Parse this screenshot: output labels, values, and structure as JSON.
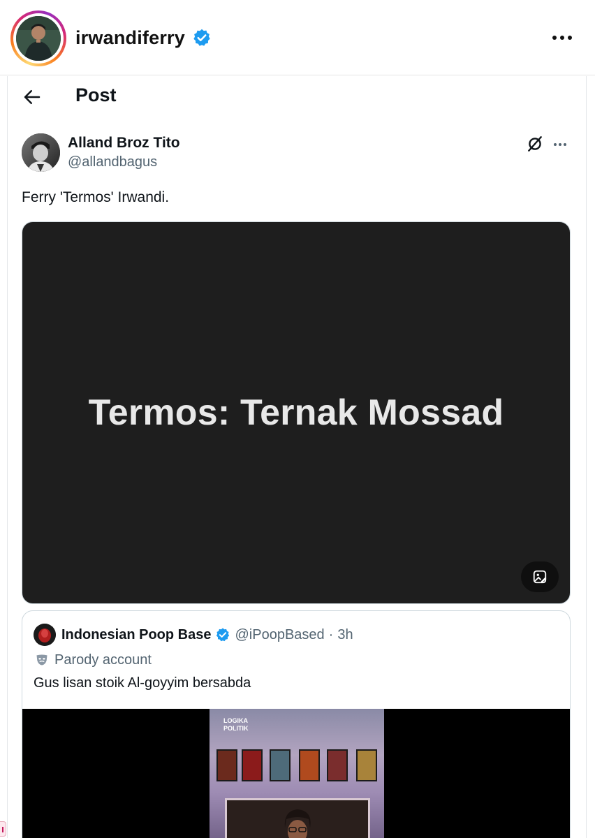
{
  "instagram_header": {
    "username": "irwandiferry",
    "verified_icon": "verified-badge-icon",
    "more_icon": "more-horizontal-icon"
  },
  "post_screen": {
    "title": "Post",
    "back_icon": "arrow-left-icon"
  },
  "post": {
    "author_name": "Alland Broz Tito",
    "author_handle": "@allandbagus",
    "text": "Ferry 'Termos' Irwandi.",
    "grok_icon": "grok-icon",
    "more_icon": "more-horizontal-icon",
    "media": {
      "caption": "Termos: Ternak Mossad",
      "background": "#1e1e1e",
      "alt_icon": "image-alt-icon"
    }
  },
  "quoted_post": {
    "author_name": "Indonesian Poop Base",
    "author_handle": "@iPoopBased",
    "separator": "·",
    "time": "3h",
    "parody_label": "Parody account",
    "parody_icon": "theater-mask-icon",
    "text": "Gus lisan stoik Al-goyyim bersabda",
    "video_logo_line1": "LOGIKA",
    "video_logo_line2": "POLITIK"
  },
  "colors": {
    "verified_blue": "#1d9bf0",
    "text_primary": "#0f1419",
    "text_secondary": "#536471",
    "border": "#cfd9de"
  }
}
